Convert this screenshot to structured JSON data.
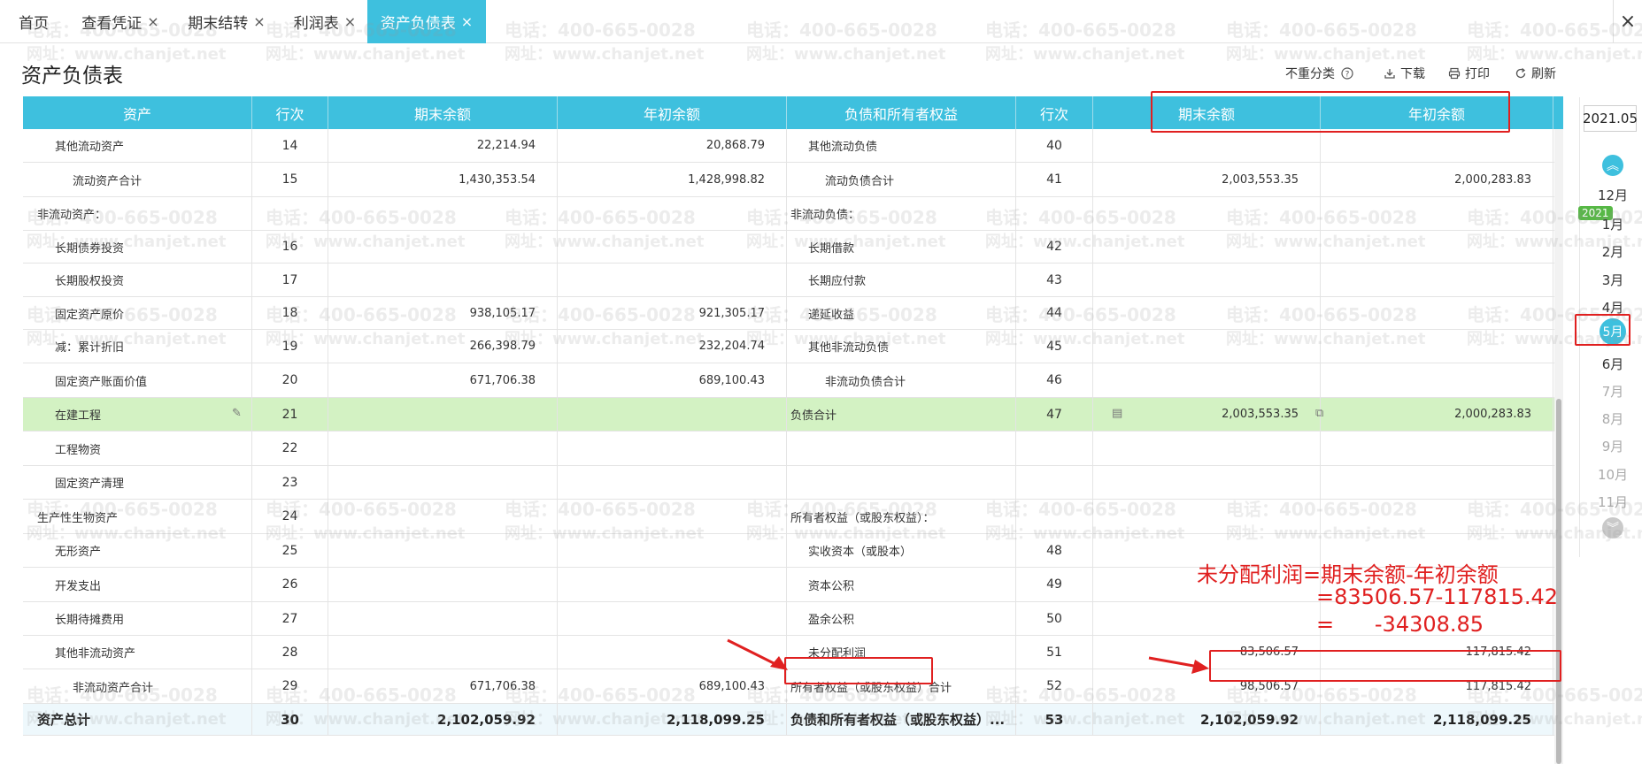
{
  "tabs": [
    {
      "label": "首页",
      "closable": false,
      "active": false
    },
    {
      "label": "查看凭证",
      "closable": true,
      "active": false
    },
    {
      "label": "期末结转",
      "closable": true,
      "active": false
    },
    {
      "label": "利润表",
      "closable": true,
      "active": false
    },
    {
      "label": "资产负债表",
      "closable": true,
      "active": true
    }
  ],
  "page_title": "资产负债表",
  "toolbar": {
    "no_reclass": "不重分类",
    "download": "下载",
    "print": "打印",
    "refresh": "刷新"
  },
  "watermark": {
    "phone": "电话：400-665-0028",
    "site": "网址：www.chanjet.net"
  },
  "columns": [
    "资产",
    "行次",
    "期末余额",
    "年初余额",
    "负债和所有者权益",
    "行次",
    "期末余额",
    "年初余额"
  ],
  "rows": [
    {
      "asset": "其他流动资产",
      "a_no": "14",
      "a_end": "22,214.94",
      "a_begin": "20,868.79",
      "liab": "其他流动负债",
      "l_no": "40",
      "l_end": "",
      "l_begin": ""
    },
    {
      "asset": "流动资产合计",
      "a_no": "15",
      "a_end": "1,430,353.54",
      "a_begin": "1,428,998.82",
      "liab": "流动负债合计",
      "l_no": "41",
      "l_end": "2,003,553.35",
      "l_begin": "2,000,283.83"
    },
    {
      "asset": "非流动资产：",
      "a_no": "",
      "a_end": "",
      "a_begin": "",
      "liab": "非流动负债：",
      "l_no": "",
      "l_end": "",
      "l_begin": ""
    },
    {
      "asset": "长期债券投资",
      "a_no": "16",
      "a_end": "",
      "a_begin": "",
      "liab": "长期借款",
      "l_no": "42",
      "l_end": "",
      "l_begin": ""
    },
    {
      "asset": "长期股权投资",
      "a_no": "17",
      "a_end": "",
      "a_begin": "",
      "liab": "长期应付款",
      "l_no": "43",
      "l_end": "",
      "l_begin": ""
    },
    {
      "asset": "固定资产原价",
      "a_no": "18",
      "a_end": "938,105.17",
      "a_begin": "921,305.17",
      "liab": "递延收益",
      "l_no": "44",
      "l_end": "",
      "l_begin": ""
    },
    {
      "asset": "减：累计折旧",
      "a_no": "19",
      "a_end": "266,398.79",
      "a_begin": "232,204.74",
      "liab": "其他非流动负债",
      "l_no": "45",
      "l_end": "",
      "l_begin": ""
    },
    {
      "asset": "固定资产账面价值",
      "a_no": "20",
      "a_end": "671,706.38",
      "a_begin": "689,100.43",
      "liab": "非流动负债合计",
      "l_no": "46",
      "l_end": "",
      "l_begin": ""
    },
    {
      "asset": "在建工程",
      "a_no": "21",
      "a_end": "",
      "a_begin": "",
      "liab": "负债合计",
      "l_no": "47",
      "l_end": "2,003,553.35",
      "l_begin": "2,000,283.83"
    },
    {
      "asset": "工程物资",
      "a_no": "22",
      "a_end": "",
      "a_begin": "",
      "liab": "",
      "l_no": "",
      "l_end": "",
      "l_begin": ""
    },
    {
      "asset": "固定资产清理",
      "a_no": "23",
      "a_end": "",
      "a_begin": "",
      "liab": "",
      "l_no": "",
      "l_end": "",
      "l_begin": ""
    },
    {
      "asset": "生产性生物资产",
      "a_no": "24",
      "a_end": "",
      "a_begin": "",
      "liab": "所有者权益（或股东权益）：",
      "l_no": "",
      "l_end": "",
      "l_begin": ""
    },
    {
      "asset": "无形资产",
      "a_no": "25",
      "a_end": "",
      "a_begin": "",
      "liab": "实收资本（或股本）",
      "l_no": "48",
      "l_end": "",
      "l_begin": ""
    },
    {
      "asset": "开发支出",
      "a_no": "26",
      "a_end": "",
      "a_begin": "",
      "liab": "资本公积",
      "l_no": "49",
      "l_end": "",
      "l_begin": ""
    },
    {
      "asset": "长期待摊费用",
      "a_no": "27",
      "a_end": "",
      "a_begin": "",
      "liab": "盈余公积",
      "l_no": "50",
      "l_end": "",
      "l_begin": ""
    },
    {
      "asset": "其他非流动资产",
      "a_no": "28",
      "a_end": "",
      "a_begin": "",
      "liab": "未分配利润",
      "l_no": "51",
      "l_end": "83,506.57",
      "l_begin": "117,815.42"
    },
    {
      "asset": "非流动资产合计",
      "a_no": "29",
      "a_end": "671,706.38",
      "a_begin": "689,100.43",
      "liab": "所有者权益（或股东权益）合计",
      "l_no": "52",
      "l_end": "98,506.57",
      "l_begin": "117,815.42"
    },
    {
      "asset": "资产总计",
      "a_no": "30",
      "a_end": "2,102,059.92",
      "a_begin": "2,118,099.25",
      "liab": "负债和所有者权益（或股东权益）...",
      "l_no": "53",
      "l_end": "2,102,059.92",
      "l_begin": "2,118,099.25"
    }
  ],
  "month_rail": {
    "year": "2021.05",
    "year_badge": "2021",
    "months": [
      "12月",
      "1月",
      "2月",
      "3月",
      "4月",
      "5月",
      "6月",
      "7月",
      "8月",
      "9月",
      "10月",
      "11月"
    ],
    "selected": "5月"
  },
  "annotation": {
    "line1": "未分配利润=期末余额-年初余额",
    "line2": "=83506.57-117815.42",
    "line3": "=      -34308.85"
  },
  "colors": {
    "accent": "#3ec0de",
    "highlight_row": "#d3f2c3",
    "annotation": "#e02020"
  }
}
